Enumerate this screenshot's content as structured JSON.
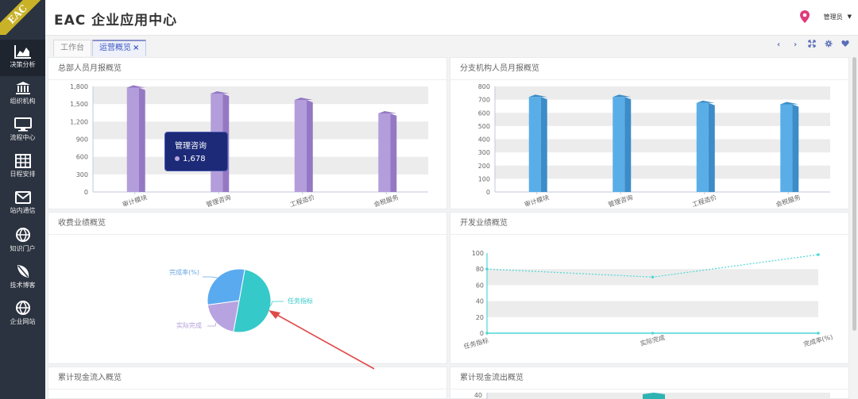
{
  "app": {
    "title": "EAC 企业应用中心",
    "logo_text": "EAC"
  },
  "user": {
    "name": "管理员"
  },
  "sidebar": {
    "items": [
      {
        "label": "决策分析",
        "icon": "area-chart-icon",
        "active": true
      },
      {
        "label": "组织机构",
        "icon": "bank-icon"
      },
      {
        "label": "流程中心",
        "icon": "monitor-icon"
      },
      {
        "label": "日程安排",
        "icon": "table-icon"
      },
      {
        "label": "站内通信",
        "icon": "envelope-icon"
      },
      {
        "label": "知识门户",
        "icon": "globe-icon"
      },
      {
        "label": "技术博客",
        "icon": "leaf-icon"
      },
      {
        "label": "企业网站",
        "icon": "globe-icon"
      }
    ]
  },
  "tabs": [
    {
      "label": "工作台",
      "active": false
    },
    {
      "label": "运营概览",
      "active": true,
      "close": "×"
    }
  ],
  "tools": [
    "prev-icon",
    "next-icon",
    "fullscreen-icon",
    "gear-icon",
    "heart-icon"
  ],
  "panels": {
    "hq": {
      "title": "总部人员月报概览"
    },
    "branch": {
      "title": "分支机构人员月报概览"
    },
    "fee": {
      "title": "收费业绩概览"
    },
    "dev": {
      "title": "开发业绩概览"
    },
    "cash_in": {
      "title": "累计现金流入概览"
    },
    "cash_out": {
      "title": "累计现金流出概览"
    }
  },
  "tooltip": {
    "name": "管理咨询",
    "value": "1,678"
  },
  "colors": {
    "sidebar": "#2b3340",
    "purple": "#b39ddb",
    "purple_dark": "#9478c4",
    "blue": "#5aaee8",
    "blue_dark": "#3b8cc8",
    "teal": "#35c9c9",
    "pie_blue": "#5aaaf0",
    "pie_purple": "#b7a3e0",
    "arrow": "#e04a4a",
    "line": "#4fd7d7"
  },
  "chart_data": [
    {
      "type": "bar",
      "title": "总部人员月报概览",
      "categories": [
        "审计模块",
        "管理咨询",
        "工程造价",
        "会税服务"
      ],
      "values": [
        1780,
        1678,
        1570,
        1340
      ],
      "ylim": [
        0,
        1800
      ],
      "yticks": [
        "0",
        "300",
        "600",
        "900",
        "1,200",
        "1,500",
        "1,800"
      ],
      "grid": true
    },
    {
      "type": "bar",
      "title": "分支机构人员月报概览",
      "categories": [
        "审计模块",
        "管理咨询",
        "工程造价",
        "会税服务"
      ],
      "values": [
        720,
        720,
        675,
        665
      ],
      "ylim": [
        0,
        800
      ],
      "yticks": [
        "0",
        "100",
        "200",
        "300",
        "400",
        "500",
        "600",
        "700",
        "800"
      ],
      "grid": true
    },
    {
      "type": "pie",
      "title": "收费业绩概览",
      "slices": [
        {
          "name": "任务指标",
          "value": 50
        },
        {
          "name": "实际完成",
          "value": 20
        },
        {
          "name": "完成率(%)",
          "value": 30
        }
      ]
    },
    {
      "type": "line",
      "title": "开发业绩概览",
      "categories": [
        "任务指标",
        "实际完成",
        "完成率(%)"
      ],
      "series": [
        {
          "values": [
            80,
            70,
            98
          ]
        },
        {
          "values": [
            0,
            0,
            0
          ]
        }
      ],
      "ylim": [
        0,
        100
      ],
      "yticks": [
        "0",
        "20",
        "40",
        "60",
        "80",
        "100"
      ],
      "grid": true
    },
    {
      "type": "bar",
      "title": "累计现金流出概览",
      "yticks": [
        "40"
      ]
    }
  ]
}
